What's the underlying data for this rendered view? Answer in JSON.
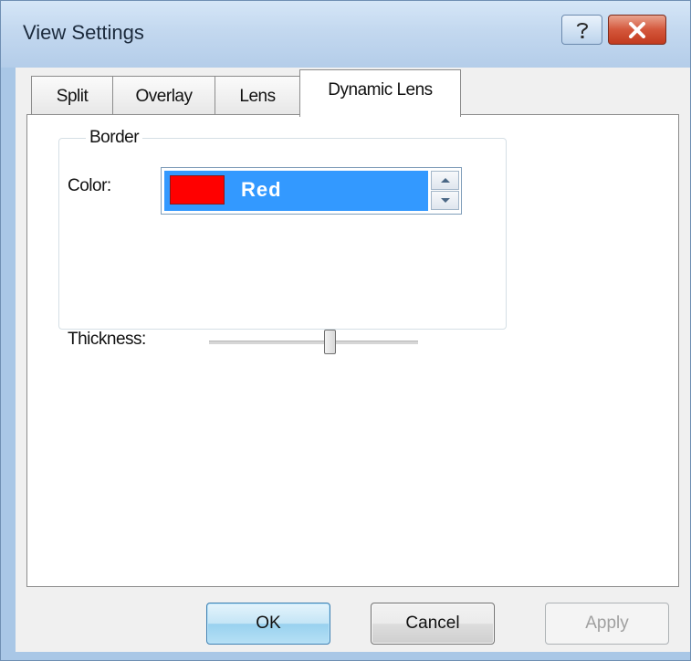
{
  "window": {
    "title": "View Settings"
  },
  "tabs": [
    {
      "label": "Split"
    },
    {
      "label": "Overlay"
    },
    {
      "label": "Lens"
    },
    {
      "label": "Dynamic Lens",
      "active": true
    }
  ],
  "border_group": {
    "title": "Border",
    "color_label": "Color:",
    "color_value": "Red",
    "swatch_color": "#ff0000",
    "thickness_label": "Thickness:",
    "thickness_level_fraction": 0.58
  },
  "buttons": {
    "ok": "OK",
    "cancel": "Cancel",
    "apply": "Apply"
  },
  "icons": [
    "help-icon",
    "close-icon",
    "spin-up-icon",
    "spin-down-icon"
  ],
  "colors": {
    "selection": "#3399ff",
    "close_button": "#c23a1e",
    "title_bar": "#c3d8ef"
  }
}
